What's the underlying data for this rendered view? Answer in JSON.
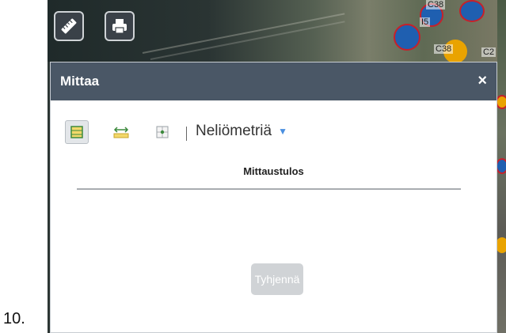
{
  "list_number": "10.",
  "toolbar": {
    "ruler_icon": "ruler-icon",
    "print_icon": "printer-icon"
  },
  "map": {
    "labels": [
      "C38",
      "I5",
      "C38",
      "C2"
    ]
  },
  "panel": {
    "title": "Mittaa",
    "close_icon": "close-icon",
    "close_glyph": "×",
    "modes": [
      {
        "icon": "area-measure-icon",
        "active": true
      },
      {
        "icon": "distance-measure-icon",
        "active": false
      },
      {
        "icon": "location-measure-icon",
        "active": false
      }
    ],
    "separator": "|",
    "unit_selected": "Neliömetriä",
    "result_heading": "Mittaustulos",
    "clear_label": "Tyhjennä"
  },
  "colors": {
    "header_bg": "#4a5766",
    "accent_caret": "#4a8fe0",
    "disabled_button": "#d0d3d6"
  }
}
